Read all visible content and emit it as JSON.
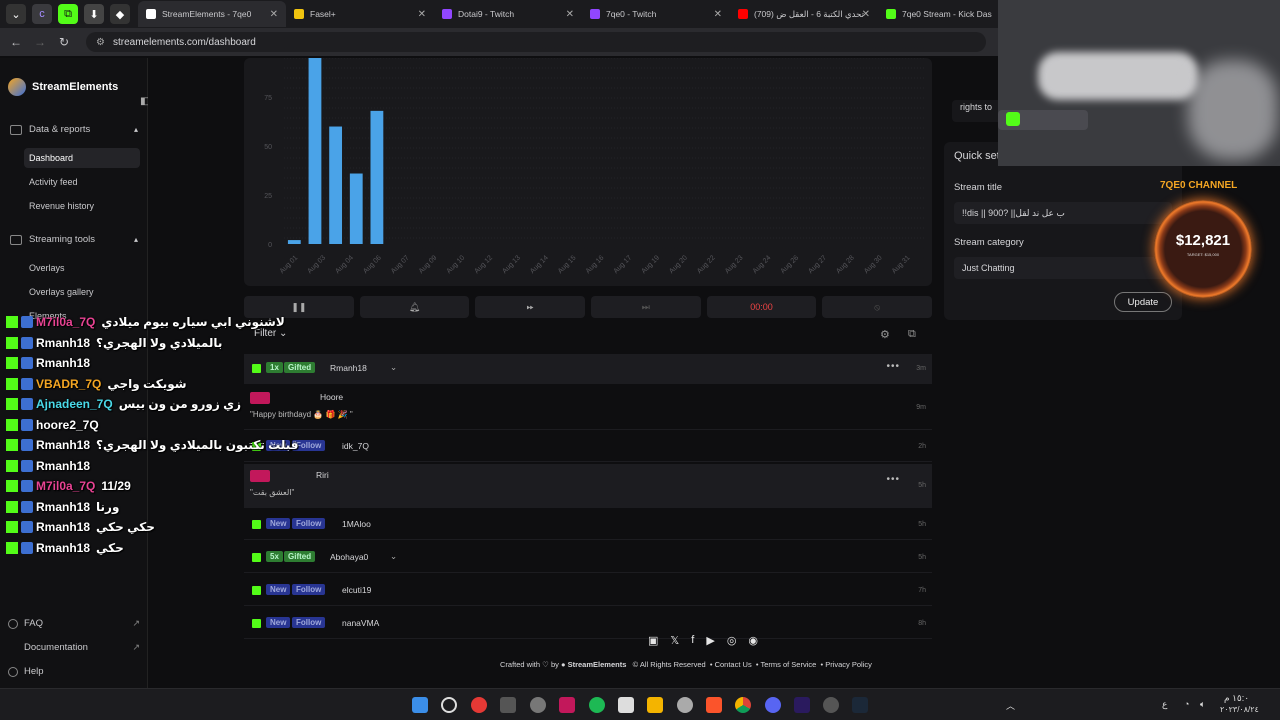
{
  "browser": {
    "tabs": [
      {
        "title": "StreamElements - 7qe0",
        "color": "#ffffff"
      },
      {
        "title": "Fasel+",
        "color": "#f1c40f"
      },
      {
        "title": "Dotai9 - Twitch",
        "color": "#9146ff"
      },
      {
        "title": "7qe0 - Twitch",
        "color": "#9146ff"
      },
      {
        "title": "(709) تحدي الكتبة 6 - العقل ض",
        "color": "#ff0000"
      },
      {
        "title": "7qe0 Stream - Kick Das",
        "color": "#53fc18"
      }
    ],
    "url": "streamelements.com/dashboard"
  },
  "sidebar": {
    "brand": "StreamElements",
    "sections": [
      {
        "label": "Data & reports",
        "items": [
          "Dashboard",
          "Activity feed",
          "Revenue history"
        ]
      },
      {
        "label": "Streaming tools",
        "items": [
          "Overlays",
          "Overlays gallery",
          "Elements"
        ]
      }
    ],
    "footer": [
      "FAQ",
      "Documentation",
      "Help"
    ]
  },
  "chart_data": {
    "type": "bar",
    "categories": [
      "Aug 01",
      "Aug 02",
      "Aug 03",
      "Aug 04",
      "Aug 05",
      "Aug 06",
      "Aug 07",
      "Aug 08",
      "Aug 09",
      "Aug 10",
      "Aug 11",
      "Aug 12",
      "Aug 13",
      "Aug 14",
      "Aug 15",
      "Aug 16",
      "Aug 17",
      "Aug 18",
      "Aug 19",
      "Aug 20",
      "Aug 21",
      "Aug 22",
      "Aug 23",
      "Aug 24",
      "Aug 25",
      "Aug 26",
      "Aug 27",
      "Aug 28",
      "Aug 29",
      "Aug 30",
      "Aug 31"
    ],
    "categories_shown": [
      "Aug 01",
      "Aug 03",
      "Aug 04",
      "Aug 06",
      "Aug 07",
      "Aug 09",
      "Aug 10",
      "Aug 12",
      "Aug 13",
      "Aug 14",
      "Aug 15",
      "Aug 16",
      "Aug 17",
      "Aug 19",
      "Aug 20",
      "Aug 22",
      "Aug 23",
      "Aug 24",
      "Aug 26",
      "Aug 27",
      "Aug 28",
      "Aug 30",
      "Aug 31"
    ],
    "values": [
      2,
      95,
      60,
      36,
      68,
      0,
      0,
      0,
      0,
      0,
      0,
      0,
      0,
      0,
      0,
      0,
      0,
      0,
      0,
      0,
      0,
      0,
      0,
      0,
      0,
      0,
      0,
      0,
      0,
      0,
      0
    ],
    "yticks": [
      "0",
      "25",
      "50",
      "75"
    ],
    "ylim": [
      0,
      95
    ],
    "xlabel": "",
    "ylabel": "",
    "color": "#4aa3e8"
  },
  "controls": {
    "timer": "00:00"
  },
  "feed": {
    "filter_label": "Filter",
    "rows": [
      {
        "badge_count": "1x",
        "badge": "Gifted",
        "user": "Rmanh18",
        "time": "3m",
        "type": "gift"
      },
      {
        "user": "Hoore",
        "message": "\"Happy birthdayd 🎂 🎁 🎉 \"",
        "time": "9m",
        "type": "tip"
      },
      {
        "badge": "New",
        "action": "Follow",
        "user": "idk_7Q",
        "time": "2h",
        "type": "follow"
      },
      {
        "user": "Riri",
        "message": "\"العشق بقت\"",
        "time": "5h",
        "type": "tip"
      },
      {
        "badge": "New",
        "action": "Follow",
        "user": "1MAloo",
        "time": "5h",
        "type": "follow"
      },
      {
        "badge_count": "5x",
        "badge": "Gifted",
        "user": "Abohaya0",
        "time": "5h",
        "type": "gift"
      },
      {
        "badge": "New",
        "action": "Follow",
        "user": "elcuti19",
        "time": "7h",
        "type": "follow"
      },
      {
        "badge": "New",
        "action": "Follow",
        "user": "nanaVMA",
        "time": "8h",
        "type": "follow"
      }
    ]
  },
  "footer": {
    "crafted_prefix": "Crafted with",
    "crafted_by": "by",
    "brand": "StreamElements",
    "rights": "© All Rights Reserved",
    "links": [
      "Contact Us",
      "Terms of Service",
      "Privacy Policy"
    ]
  },
  "right_panel": {
    "rights_text": "rights to",
    "title": "Quick set",
    "stream_title_label": "Stream title",
    "stream_title_value": "!!dis || 900? ||ب عل ند لقل",
    "category_label": "Stream category",
    "category_value": "Just Chatting",
    "update_label": "Update"
  },
  "donation_widget": {
    "channel": "7QE0 CHANNEL",
    "amount": "$12,821",
    "target": "TARGET: $15,000"
  },
  "chat_overlay": [
    {
      "user": "M7il0a_7Q",
      "text": "لاشنوني ابي سياره بيوم ميلادي",
      "color": "#e84393"
    },
    {
      "user": "Rmanh18",
      "text": "بالميلادي ولا الهجري؟",
      "color": "#ffffff"
    },
    {
      "user": "Rmanh18",
      "text": "",
      "color": "#ffffff"
    },
    {
      "user": "VBADR_7Q",
      "text": "شويكت واجي",
      "color": "#f5a623"
    },
    {
      "user": "Ajnadeen_7Q",
      "text": "زي زورو من ون بيس",
      "color": "#4ad9e8"
    },
    {
      "user": "hoore2_7Q",
      "text": "",
      "color": "#ffffff"
    },
    {
      "user": "Rmanh18",
      "text": "قبلت تكتبون بالميلادي ولا الهجري؟",
      "color": "#ffffff"
    },
    {
      "user": "Rmanh18",
      "text": "",
      "color": "#ffffff"
    },
    {
      "user": "M7il0a_7Q",
      "text": "11/29",
      "color": "#e84393"
    },
    {
      "user": "Rmanh18",
      "text": "ورنا",
      "color": "#ffffff"
    },
    {
      "user": "Rmanh18",
      "text": "حكي حكي",
      "color": "#ffffff"
    },
    {
      "user": "Rmanh18",
      "text": "حكي",
      "color": "#ffffff"
    }
  ],
  "taskbar": {
    "clock": "١٥:٠ م",
    "date": "٢٠٢٣/٠٨/٢٤",
    "lang": "ع"
  }
}
